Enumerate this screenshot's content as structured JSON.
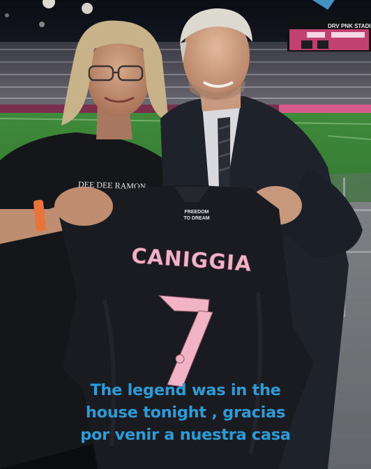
{
  "scoreboard": {
    "stadium_label": "DRV PNK STADIU",
    "panel_color": "#f08ab5"
  },
  "shirt_text": {
    "band_name": "DEE DEE RAMON",
    "sponsor": "FREEDOM TO DREAM"
  },
  "jersey": {
    "name": "CANIGGIA",
    "number": "7",
    "trim_color": "#f4b6c8"
  },
  "caption": {
    "line_1": "The legend was in the",
    "line_2": "house tonight , gracias",
    "line_3": "por venir a nuestra casa",
    "color": "#2f9bd6"
  }
}
